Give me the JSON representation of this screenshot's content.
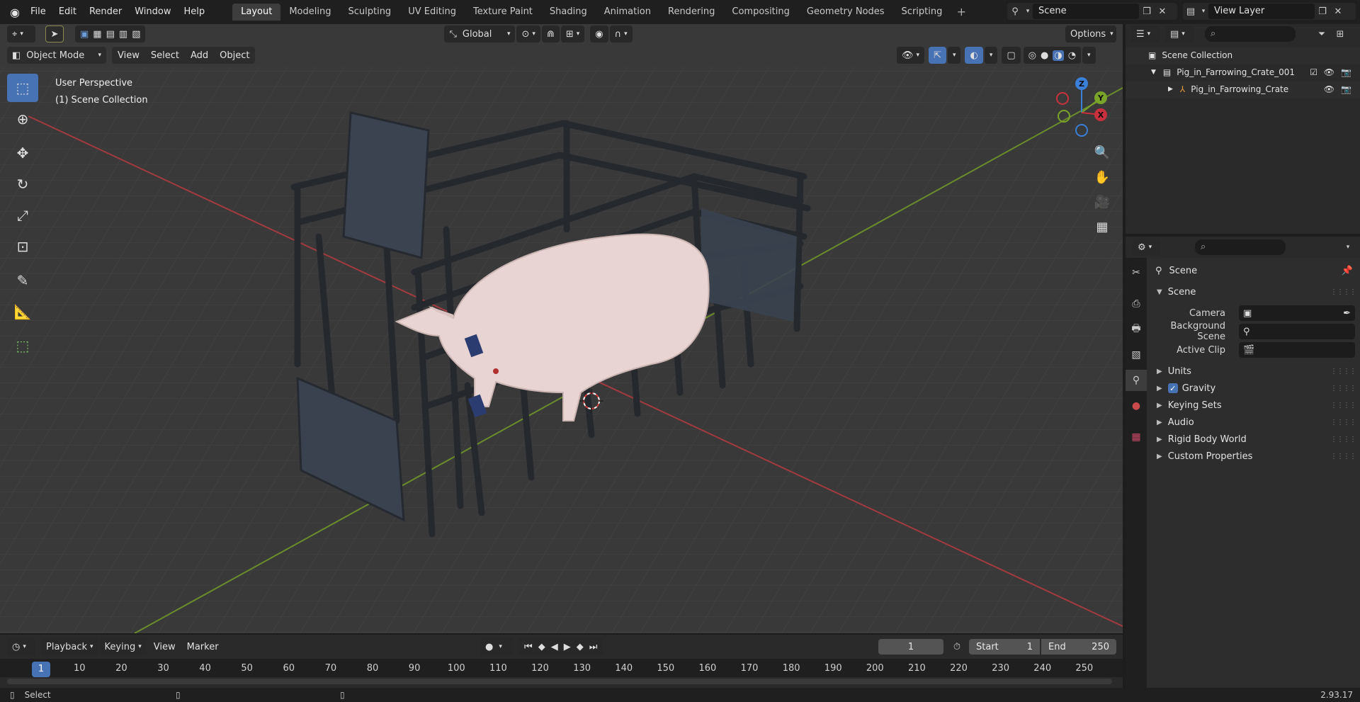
{
  "menubar": {
    "items": [
      "File",
      "Edit",
      "Render",
      "Window",
      "Help"
    ],
    "workspaces": [
      "Layout",
      "Modeling",
      "Sculpting",
      "UV Editing",
      "Texture Paint",
      "Shading",
      "Animation",
      "Rendering",
      "Compositing",
      "Geometry Nodes",
      "Scripting"
    ],
    "active_workspace": "Layout",
    "scene_name": "Scene",
    "view_layer": "View Layer"
  },
  "viewport": {
    "mode": "Object Mode",
    "menus": [
      "View",
      "Select",
      "Add",
      "Object"
    ],
    "transform_orientation": "Global",
    "options_label": "Options",
    "perspective_label": "User Perspective",
    "collection_label": "(1) Scene Collection",
    "gizmo_axes": {
      "x": "X",
      "y": "Y",
      "z": "Z"
    }
  },
  "timeline": {
    "menus": [
      "Playback",
      "Keying",
      "View",
      "Marker"
    ],
    "current_frame": "1",
    "start_label": "Start",
    "start_value": "1",
    "end_label": "End",
    "end_value": "250",
    "ticks": [
      "10",
      "20",
      "30",
      "40",
      "50",
      "60",
      "70",
      "80",
      "90",
      "100",
      "110",
      "120",
      "130",
      "140",
      "150",
      "160",
      "170",
      "180",
      "190",
      "200",
      "210",
      "220",
      "230",
      "240",
      "250"
    ],
    "cursor_frame": "1"
  },
  "statusbar": {
    "select_label": "Select",
    "version": "2.93.17"
  },
  "outliner": {
    "root": "Scene Collection",
    "items": [
      {
        "label": "Pig_in_Farrowing_Crate_001",
        "level": 1
      },
      {
        "label": "Pig_in_Farrowing_Crate",
        "level": 2
      }
    ]
  },
  "properties": {
    "context_title": "Scene",
    "panel_scene": "Scene",
    "camera_label": "Camera",
    "background_scene_label": "Background Scene",
    "active_clip_label": "Active Clip",
    "panels": [
      "Units",
      "Gravity",
      "Keying Sets",
      "Audio",
      "Rigid Body World",
      "Custom Properties"
    ]
  },
  "colors": {
    "accent": "#4772b3",
    "x_axis": "#c8303d",
    "y_axis": "#7aa32a",
    "z_axis": "#3a7fd8"
  }
}
